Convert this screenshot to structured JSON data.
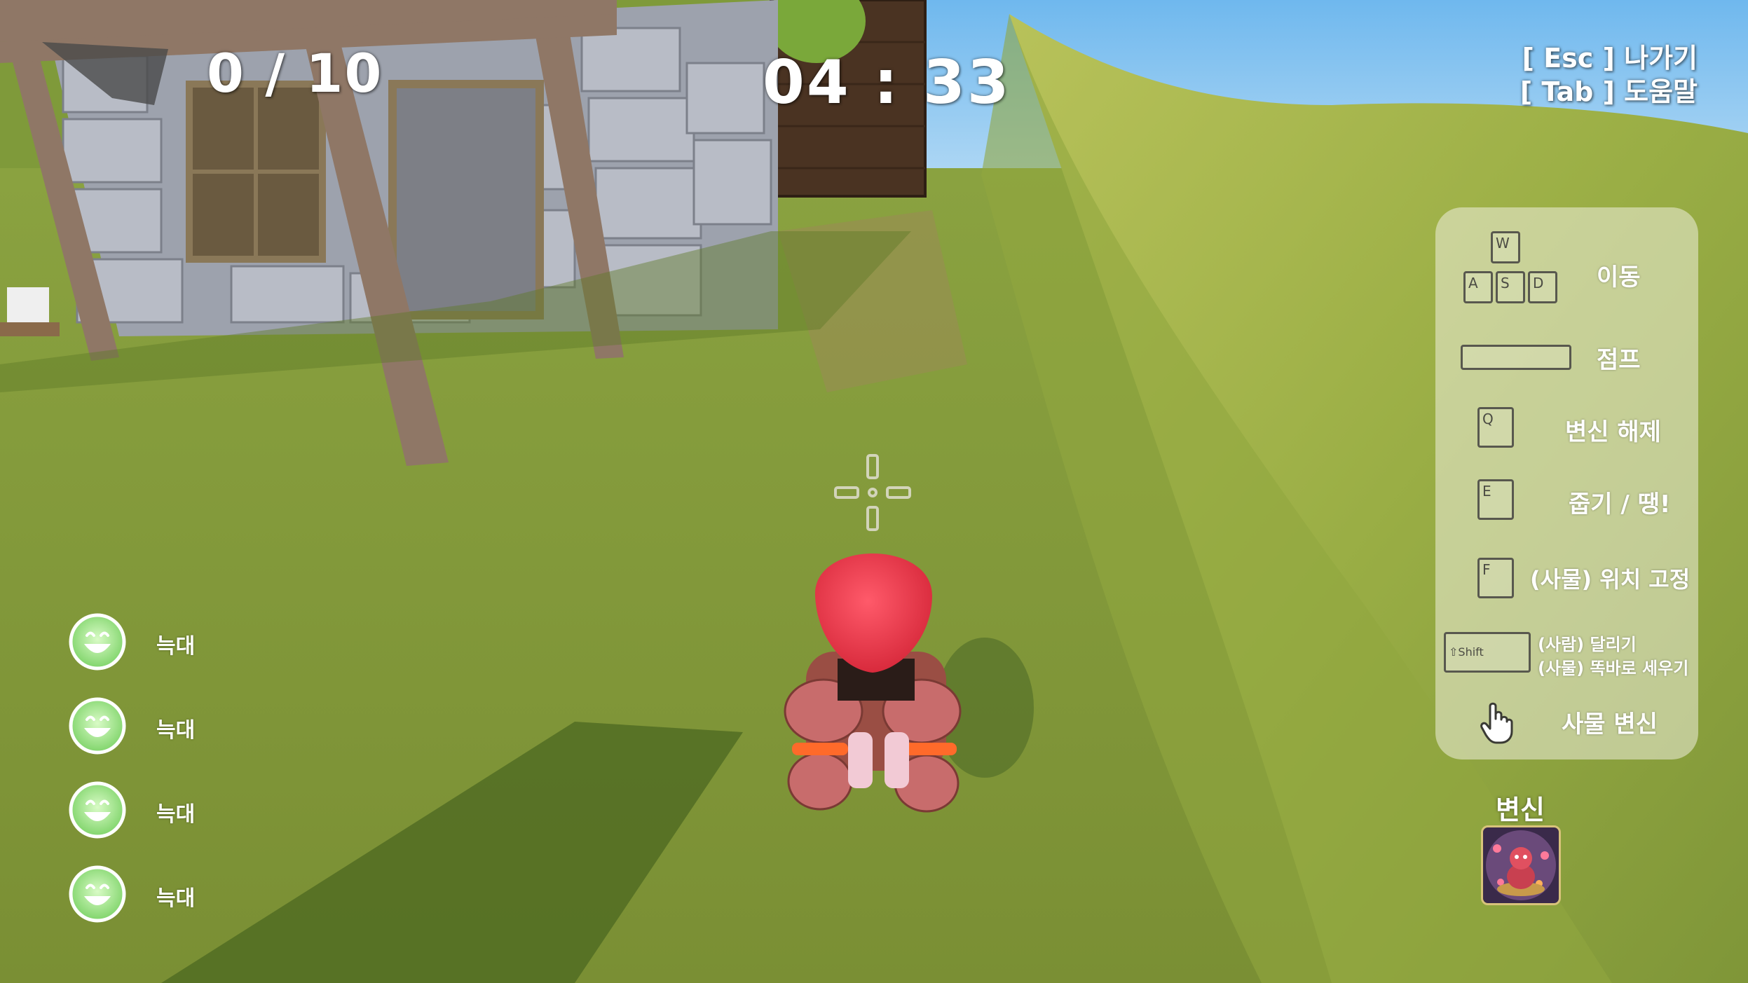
{
  "hud": {
    "score": "0 / 10",
    "timer": "04 : 33",
    "esc_hint": "[ Esc ] 나가기",
    "tab_hint": "[ Tab ] 도움말"
  },
  "help": {
    "move": {
      "keys": [
        "W",
        "A",
        "S",
        "D"
      ],
      "label": "이동"
    },
    "jump": {
      "label": "점프"
    },
    "untransform": {
      "key": "Q",
      "label": "변신 해제"
    },
    "grab": {
      "key": "E",
      "label": "줍기 / 땡!"
    },
    "fix": {
      "key": "F",
      "label": "(사물) 위치 고정"
    },
    "shift": {
      "key": "⇧Shift",
      "line1": "(사람) 달리기",
      "line2": "(사물) 똑바로 세우기"
    },
    "click": {
      "icon": "hand-pointer-icon",
      "label": "사물 변신"
    }
  },
  "players": [
    {
      "name": "늑대",
      "icon": "smiley-icon"
    },
    {
      "name": "늑대",
      "icon": "smiley-icon"
    },
    {
      "name": "늑대",
      "icon": "smiley-icon"
    },
    {
      "name": "늑대",
      "icon": "smiley-icon"
    }
  ],
  "transform": {
    "label": "변신"
  },
  "colors": {
    "grass": "#7f9a3a",
    "sky": "#cfe6f7",
    "player_icon": "#7fd46a",
    "character_head": "#e5384a"
  }
}
